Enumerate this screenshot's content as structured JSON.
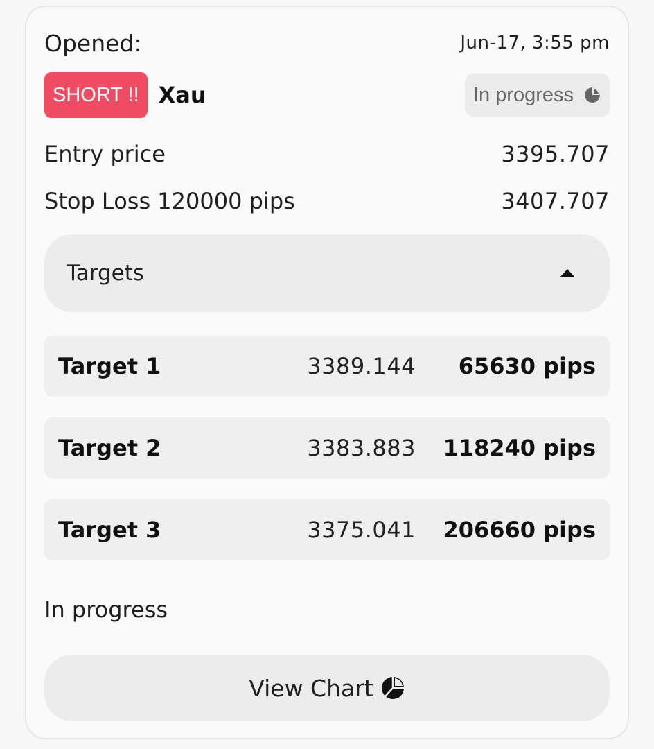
{
  "header": {
    "opened_label": "Opened:",
    "opened_time": "Jun-17, 3:55 pm"
  },
  "signal": {
    "direction_badge": "SHORT !!",
    "pair": "Xau",
    "status": "In progress",
    "status_icon": "pie-progress-icon",
    "badge_color": "#ef4b62"
  },
  "entry": {
    "label": "Entry price",
    "value": "3395.707"
  },
  "stop_loss": {
    "label": "Stop Loss 120000 pips",
    "value": "3407.707"
  },
  "targets": {
    "title": "Targets",
    "toggle_icon": "caret-up-icon",
    "items": [
      {
        "name": "Target 1",
        "price": "3389.144",
        "pips": "65630 pips"
      },
      {
        "name": "Target 2",
        "price": "3383.883",
        "pips": "118240 pips"
      },
      {
        "name": "Target 3",
        "price": "3375.041",
        "pips": "206660 pips"
      }
    ]
  },
  "footer": {
    "status_text": "In progress",
    "view_chart_label": "View Chart",
    "view_chart_icon": "pie-chart-icon"
  }
}
